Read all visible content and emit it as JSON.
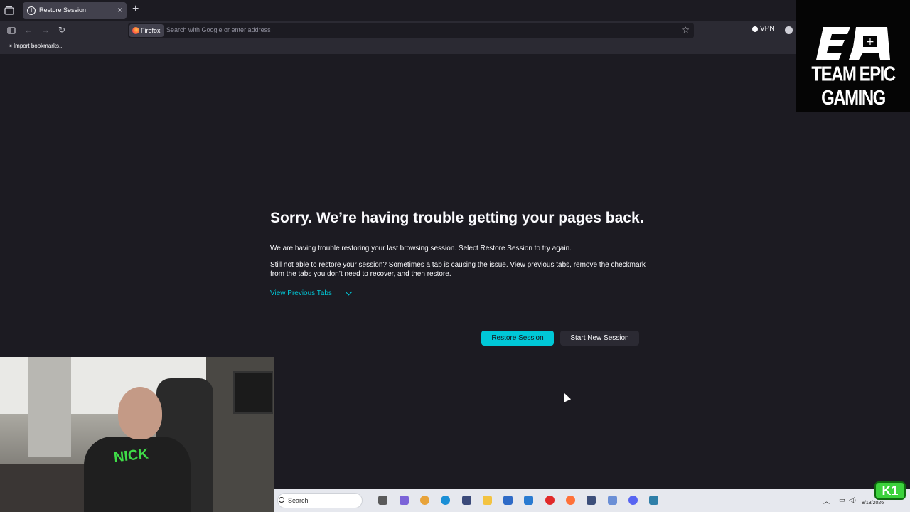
{
  "browser": {
    "tab_title": "Restore Session",
    "url_chip": "Firefox",
    "url_placeholder": "Search with Google or enter address",
    "vpn_label": "VPN",
    "bookmarks_import": "Import bookmarks..."
  },
  "overlay": {
    "logo_text": "TEAM EPIC GAMING",
    "badge_text": "K1",
    "webcam_shirt_text": "NICK"
  },
  "page": {
    "heading": "Sorry. We’re having trouble getting your pages back.",
    "para1": "We are having trouble restoring your last browsing session. Select Restore Session to try again.",
    "para2": "Still not able to restore your session? Sometimes a tab is causing the issue. View previous tabs, remove the checkmark from the tabs you don’t need to recover, and then restore.",
    "view_previous": "View Previous Tabs",
    "restore_button": "Restore Session",
    "new_session_button": "Start New Session"
  },
  "taskbar": {
    "search_label": "Search",
    "date": "8/13/2026",
    "time": "4:2"
  },
  "colors": {
    "accent": "#00c8d7",
    "bg": "#1c1b22",
    "toolbar": "#2b2a33"
  }
}
